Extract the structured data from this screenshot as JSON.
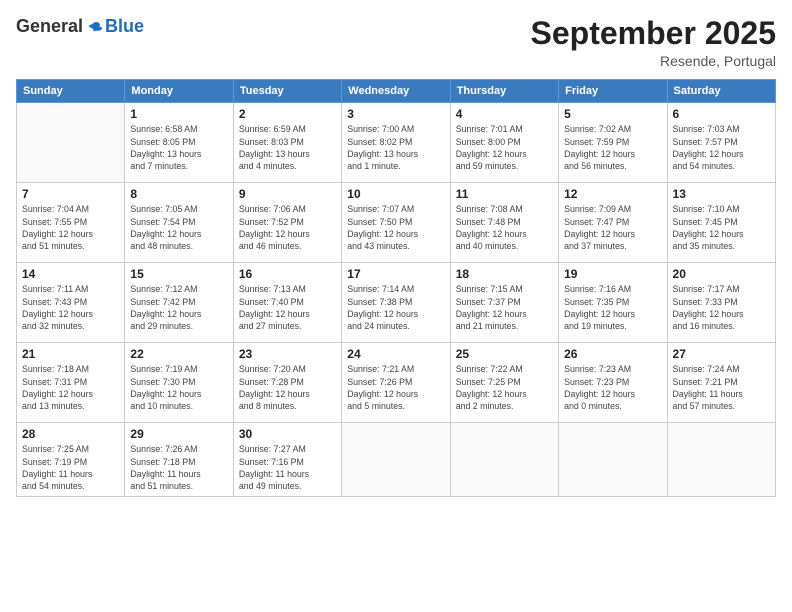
{
  "logo": {
    "general": "General",
    "blue": "Blue"
  },
  "header": {
    "title": "September 2025",
    "subtitle": "Resende, Portugal"
  },
  "days_of_week": [
    "Sunday",
    "Monday",
    "Tuesday",
    "Wednesday",
    "Thursday",
    "Friday",
    "Saturday"
  ],
  "weeks": [
    [
      {
        "day": "",
        "info": ""
      },
      {
        "day": "1",
        "info": "Sunrise: 6:58 AM\nSunset: 8:05 PM\nDaylight: 13 hours\nand 7 minutes."
      },
      {
        "day": "2",
        "info": "Sunrise: 6:59 AM\nSunset: 8:03 PM\nDaylight: 13 hours\nand 4 minutes."
      },
      {
        "day": "3",
        "info": "Sunrise: 7:00 AM\nSunset: 8:02 PM\nDaylight: 13 hours\nand 1 minute."
      },
      {
        "day": "4",
        "info": "Sunrise: 7:01 AM\nSunset: 8:00 PM\nDaylight: 12 hours\nand 59 minutes."
      },
      {
        "day": "5",
        "info": "Sunrise: 7:02 AM\nSunset: 7:59 PM\nDaylight: 12 hours\nand 56 minutes."
      },
      {
        "day": "6",
        "info": "Sunrise: 7:03 AM\nSunset: 7:57 PM\nDaylight: 12 hours\nand 54 minutes."
      }
    ],
    [
      {
        "day": "7",
        "info": "Sunrise: 7:04 AM\nSunset: 7:55 PM\nDaylight: 12 hours\nand 51 minutes."
      },
      {
        "day": "8",
        "info": "Sunrise: 7:05 AM\nSunset: 7:54 PM\nDaylight: 12 hours\nand 48 minutes."
      },
      {
        "day": "9",
        "info": "Sunrise: 7:06 AM\nSunset: 7:52 PM\nDaylight: 12 hours\nand 46 minutes."
      },
      {
        "day": "10",
        "info": "Sunrise: 7:07 AM\nSunset: 7:50 PM\nDaylight: 12 hours\nand 43 minutes."
      },
      {
        "day": "11",
        "info": "Sunrise: 7:08 AM\nSunset: 7:48 PM\nDaylight: 12 hours\nand 40 minutes."
      },
      {
        "day": "12",
        "info": "Sunrise: 7:09 AM\nSunset: 7:47 PM\nDaylight: 12 hours\nand 37 minutes."
      },
      {
        "day": "13",
        "info": "Sunrise: 7:10 AM\nSunset: 7:45 PM\nDaylight: 12 hours\nand 35 minutes."
      }
    ],
    [
      {
        "day": "14",
        "info": "Sunrise: 7:11 AM\nSunset: 7:43 PM\nDaylight: 12 hours\nand 32 minutes."
      },
      {
        "day": "15",
        "info": "Sunrise: 7:12 AM\nSunset: 7:42 PM\nDaylight: 12 hours\nand 29 minutes."
      },
      {
        "day": "16",
        "info": "Sunrise: 7:13 AM\nSunset: 7:40 PM\nDaylight: 12 hours\nand 27 minutes."
      },
      {
        "day": "17",
        "info": "Sunrise: 7:14 AM\nSunset: 7:38 PM\nDaylight: 12 hours\nand 24 minutes."
      },
      {
        "day": "18",
        "info": "Sunrise: 7:15 AM\nSunset: 7:37 PM\nDaylight: 12 hours\nand 21 minutes."
      },
      {
        "day": "19",
        "info": "Sunrise: 7:16 AM\nSunset: 7:35 PM\nDaylight: 12 hours\nand 19 minutes."
      },
      {
        "day": "20",
        "info": "Sunrise: 7:17 AM\nSunset: 7:33 PM\nDaylight: 12 hours\nand 16 minutes."
      }
    ],
    [
      {
        "day": "21",
        "info": "Sunrise: 7:18 AM\nSunset: 7:31 PM\nDaylight: 12 hours\nand 13 minutes."
      },
      {
        "day": "22",
        "info": "Sunrise: 7:19 AM\nSunset: 7:30 PM\nDaylight: 12 hours\nand 10 minutes."
      },
      {
        "day": "23",
        "info": "Sunrise: 7:20 AM\nSunset: 7:28 PM\nDaylight: 12 hours\nand 8 minutes."
      },
      {
        "day": "24",
        "info": "Sunrise: 7:21 AM\nSunset: 7:26 PM\nDaylight: 12 hours\nand 5 minutes."
      },
      {
        "day": "25",
        "info": "Sunrise: 7:22 AM\nSunset: 7:25 PM\nDaylight: 12 hours\nand 2 minutes."
      },
      {
        "day": "26",
        "info": "Sunrise: 7:23 AM\nSunset: 7:23 PM\nDaylight: 12 hours\nand 0 minutes."
      },
      {
        "day": "27",
        "info": "Sunrise: 7:24 AM\nSunset: 7:21 PM\nDaylight: 11 hours\nand 57 minutes."
      }
    ],
    [
      {
        "day": "28",
        "info": "Sunrise: 7:25 AM\nSunset: 7:19 PM\nDaylight: 11 hours\nand 54 minutes."
      },
      {
        "day": "29",
        "info": "Sunrise: 7:26 AM\nSunset: 7:18 PM\nDaylight: 11 hours\nand 51 minutes."
      },
      {
        "day": "30",
        "info": "Sunrise: 7:27 AM\nSunset: 7:16 PM\nDaylight: 11 hours\nand 49 minutes."
      },
      {
        "day": "",
        "info": ""
      },
      {
        "day": "",
        "info": ""
      },
      {
        "day": "",
        "info": ""
      },
      {
        "day": "",
        "info": ""
      }
    ]
  ]
}
